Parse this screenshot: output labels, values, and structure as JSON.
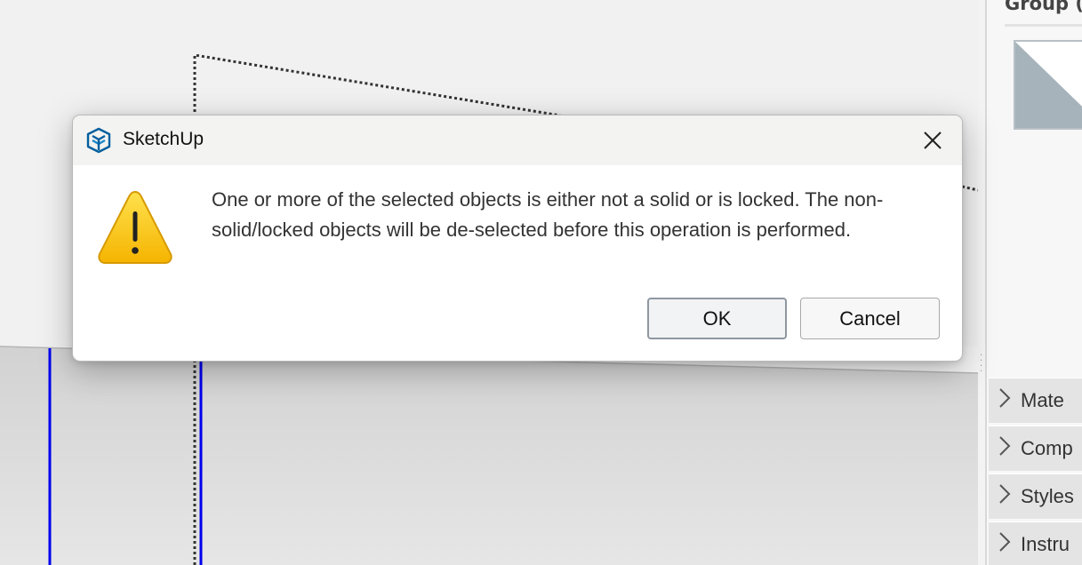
{
  "dialog": {
    "title": "SketchUp",
    "message": "One or more of the selected objects is either not a solid or is locked. The non-solid/locked objects will be de-selected before this operation is performed.",
    "ok_label": "OK",
    "cancel_label": "Cancel"
  },
  "tray": {
    "entity_title": "Group (",
    "panels": [
      {
        "label": "Mate"
      },
      {
        "label": "Comp"
      },
      {
        "label": "Styles"
      },
      {
        "label": "Instru"
      }
    ]
  },
  "colors": {
    "accent_blue_edge": "#0000ee",
    "sketchup_brand": "#005f9e",
    "warning_yellow": "#f5c211"
  },
  "icons": {
    "app": "sketchup-logo-icon",
    "warning": "warning-triangle-icon",
    "close": "close-icon",
    "panel_expand": "chevron-right-icon"
  }
}
